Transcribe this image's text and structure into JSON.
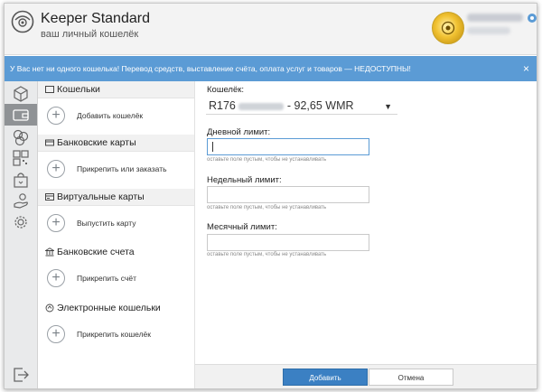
{
  "header": {
    "app_title": "Keeper Standard",
    "app_subtitle": "ваш личный кошелёк"
  },
  "banner": {
    "message": "У Вас нет ни одного кошелька! Перевод средств, выставление счёта, оплата услуг и товаров — НЕДОСТУПНЫ!",
    "close_glyph": "×"
  },
  "sidebar": {
    "icons": [
      "globe-cube-icon",
      "wallet-icon",
      "coins-icon",
      "qr-grid-icon",
      "shop-bag-icon",
      "hand-icon",
      "gear-icon",
      "logout-icon"
    ]
  },
  "sections": [
    {
      "title": "Кошельки",
      "action": "Добавить кошелёк",
      "icon": "wallet-small-icon"
    },
    {
      "title": "Банковские карты",
      "action": "Прикрепить или заказать",
      "icon": "card-icon"
    },
    {
      "title": "Виртуальные карты",
      "action": "Выпустить карту",
      "icon": "virtual-card-icon"
    },
    {
      "title": "Банковские счета",
      "action": "Прикрепить счёт",
      "icon": "bank-icon"
    },
    {
      "title": "Электронные кошельки",
      "action": "Прикрепить кошелёк",
      "icon": "ewallet-icon"
    }
  ],
  "form": {
    "wallet_label": "Кошелёк:",
    "wallet_prefix": "R176",
    "wallet_suffix": "- 92,65 WMR",
    "daily_label": "Дневной лимит:",
    "weekly_label": "Недельный лимит:",
    "monthly_label": "Месячный лимит:",
    "hint": "оставьте поле пустым, чтобы не устанавливать",
    "daily_value": "",
    "weekly_value": "",
    "monthly_value": ""
  },
  "footer": {
    "add_label": "Добавить",
    "cancel_label": "Отмена"
  },
  "colors": {
    "banner": "#5b9bd5",
    "primary_button": "#3b80c3",
    "sidebar": "#e9eaeb"
  }
}
